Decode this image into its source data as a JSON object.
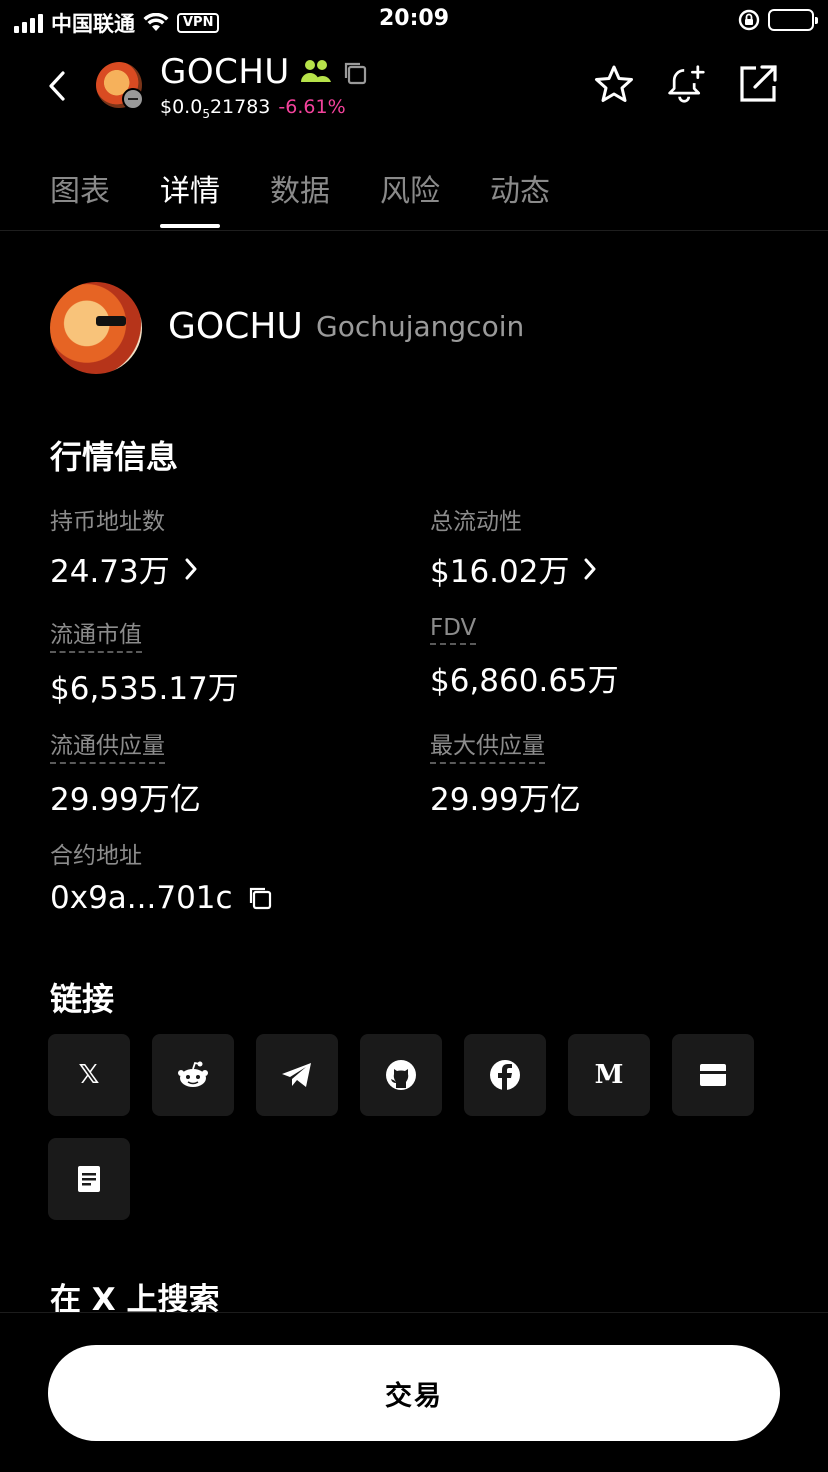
{
  "status_bar": {
    "carrier": "中国联通",
    "vpn": "VPN",
    "time": "20:09"
  },
  "header": {
    "symbol": "GOCHU",
    "price_prefix": "$0.0",
    "price_sub": "5",
    "price_rest": "21783",
    "change": "-6.61%",
    "change_color": "#f3429b"
  },
  "tabs": [
    {
      "label": "图表",
      "active": false
    },
    {
      "label": "详情",
      "active": true
    },
    {
      "label": "数据",
      "active": false
    },
    {
      "label": "风险",
      "active": false
    },
    {
      "label": "动态",
      "active": false
    }
  ],
  "token": {
    "symbol": "GOCHU",
    "name": "Gochujangcoin"
  },
  "market": {
    "title": "行情信息",
    "holders": {
      "label": "持币地址数",
      "value": "24.73万"
    },
    "liquidity": {
      "label": "总流动性",
      "value": "$16.02万"
    },
    "circ_mcap": {
      "label": "流通市值",
      "value": "$6,535.17万"
    },
    "fdv": {
      "label": "FDV",
      "value": "$6,860.65万"
    },
    "circ_supply": {
      "label": "流通供应量",
      "value": "29.99万亿"
    },
    "max_supply": {
      "label": "最大供应量",
      "value": "29.99万亿"
    },
    "contract": {
      "label": "合约地址",
      "value": "0x9a...701c"
    }
  },
  "links": {
    "title": "链接",
    "items": [
      {
        "name": "x-icon",
        "glyph": "𝕏"
      },
      {
        "name": "reddit-icon",
        "glyph": ""
      },
      {
        "name": "telegram-icon",
        "glyph": ""
      },
      {
        "name": "github-icon",
        "glyph": ""
      },
      {
        "name": "facebook-icon",
        "glyph": ""
      },
      {
        "name": "medium-icon",
        "glyph": "M"
      },
      {
        "name": "website-icon",
        "glyph": ""
      },
      {
        "name": "document-icon",
        "glyph": ""
      }
    ]
  },
  "search_section": {
    "title": "在 X 上搜索"
  },
  "bottom": {
    "trade_label": "交易"
  }
}
